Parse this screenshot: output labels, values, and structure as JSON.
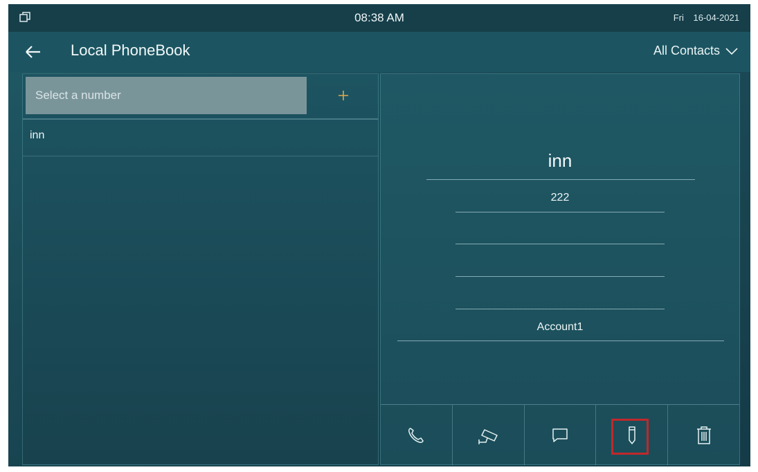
{
  "status_bar": {
    "time": "08:38 AM",
    "day": "Fri",
    "date": "16-04-2021"
  },
  "header": {
    "title": "Local PhoneBook",
    "filter_label": "All Contacts"
  },
  "search": {
    "placeholder": "Select a number"
  },
  "contacts": [
    {
      "name": "inn"
    }
  ],
  "detail": {
    "name": "inn",
    "number": "222",
    "field_2": "",
    "field_3": "",
    "field_4": "",
    "account": "Account1"
  },
  "actions": [
    {
      "icon": "phone-icon"
    },
    {
      "icon": "camera-icon"
    },
    {
      "icon": "message-icon"
    },
    {
      "icon": "edit-icon",
      "highlighted": true
    },
    {
      "icon": "trash-icon"
    }
  ],
  "colors": {
    "background": "#1a4955",
    "search_field": "#7a959a",
    "add_accent": "#e0a94a",
    "highlight": "#c1282b"
  }
}
